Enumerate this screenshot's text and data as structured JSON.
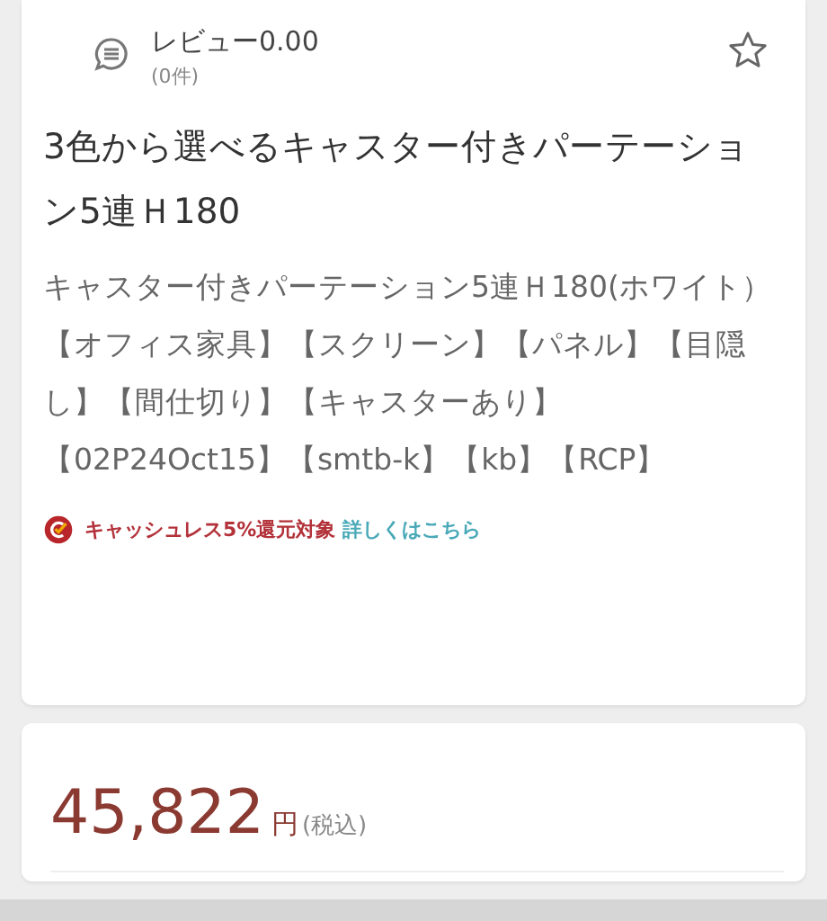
{
  "review": {
    "label": "レビュー0.00",
    "count": "(0件)",
    "favorite": false
  },
  "product": {
    "title": "3色から選べるキャスター付きパーテーション5連Ｈ180",
    "description": "キャスター付きパーテーション5連Ｈ180(ホワイト）【オフィス家具】【スクリーン】【パネル】【目隠し】【間仕切り】【キャスターあり】【02P24Oct15】【smtb-k】【kb】【RCP】"
  },
  "cashless": {
    "text": "キャッシュレス5%還元対象",
    "link": "詳しくはこちら"
  },
  "price": {
    "amount": "45,822",
    "unit": "円",
    "tax": "(税込)"
  }
}
